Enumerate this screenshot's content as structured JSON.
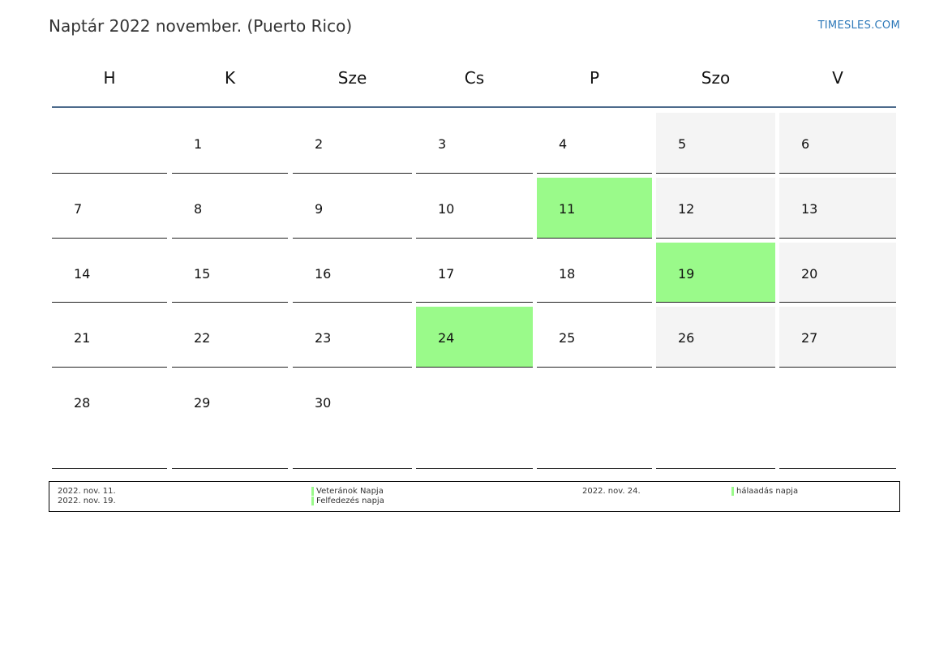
{
  "title": "Naptár 2022 november. (Puerto Rico)",
  "brand": "TIMESLES.COM",
  "colors": {
    "holiday": "#9afa8a",
    "weekend": "#f4f4f4",
    "header_line": "#4d6b8c",
    "brand": "#2e79b9"
  },
  "weekdays": [
    "H",
    "K",
    "Sze",
    "Cs",
    "P",
    "Szo",
    "V"
  ],
  "weeks": [
    [
      {
        "day": "",
        "weekend": false,
        "holiday": false
      },
      {
        "day": "1",
        "weekend": false,
        "holiday": false
      },
      {
        "day": "2",
        "weekend": false,
        "holiday": false
      },
      {
        "day": "3",
        "weekend": false,
        "holiday": false
      },
      {
        "day": "4",
        "weekend": false,
        "holiday": false
      },
      {
        "day": "5",
        "weekend": true,
        "holiday": false
      },
      {
        "day": "6",
        "weekend": true,
        "holiday": false
      }
    ],
    [
      {
        "day": "7",
        "weekend": false,
        "holiday": false
      },
      {
        "day": "8",
        "weekend": false,
        "holiday": false
      },
      {
        "day": "9",
        "weekend": false,
        "holiday": false
      },
      {
        "day": "10",
        "weekend": false,
        "holiday": false
      },
      {
        "day": "11",
        "weekend": false,
        "holiday": true
      },
      {
        "day": "12",
        "weekend": true,
        "holiday": false
      },
      {
        "day": "13",
        "weekend": true,
        "holiday": false
      }
    ],
    [
      {
        "day": "14",
        "weekend": false,
        "holiday": false
      },
      {
        "day": "15",
        "weekend": false,
        "holiday": false
      },
      {
        "day": "16",
        "weekend": false,
        "holiday": false
      },
      {
        "day": "17",
        "weekend": false,
        "holiday": false
      },
      {
        "day": "18",
        "weekend": false,
        "holiday": false
      },
      {
        "day": "19",
        "weekend": true,
        "holiday": true
      },
      {
        "day": "20",
        "weekend": true,
        "holiday": false
      }
    ],
    [
      {
        "day": "21",
        "weekend": false,
        "holiday": false
      },
      {
        "day": "22",
        "weekend": false,
        "holiday": false
      },
      {
        "day": "23",
        "weekend": false,
        "holiday": false
      },
      {
        "day": "24",
        "weekend": false,
        "holiday": true
      },
      {
        "day": "25",
        "weekend": false,
        "holiday": false
      },
      {
        "day": "26",
        "weekend": true,
        "holiday": false
      },
      {
        "day": "27",
        "weekend": true,
        "holiday": false
      }
    ],
    [
      {
        "day": "28",
        "weekend": false,
        "holiday": false
      },
      {
        "day": "29",
        "weekend": false,
        "holiday": false
      },
      {
        "day": "30",
        "weekend": false,
        "holiday": false
      },
      {
        "day": "",
        "weekend": false,
        "holiday": false
      },
      {
        "day": "",
        "weekend": false,
        "holiday": false
      },
      {
        "day": "",
        "weekend": false,
        "holiday": false
      },
      {
        "day": "",
        "weekend": false,
        "holiday": false
      }
    ]
  ],
  "holidays": [
    {
      "date": "2022. nov. 11.",
      "name": "Veteránok Napja"
    },
    {
      "date": "2022. nov. 19.",
      "name": "Felfedezés napja"
    },
    {
      "date": "2022. nov. 24.",
      "name": "hálaadás napja"
    }
  ]
}
